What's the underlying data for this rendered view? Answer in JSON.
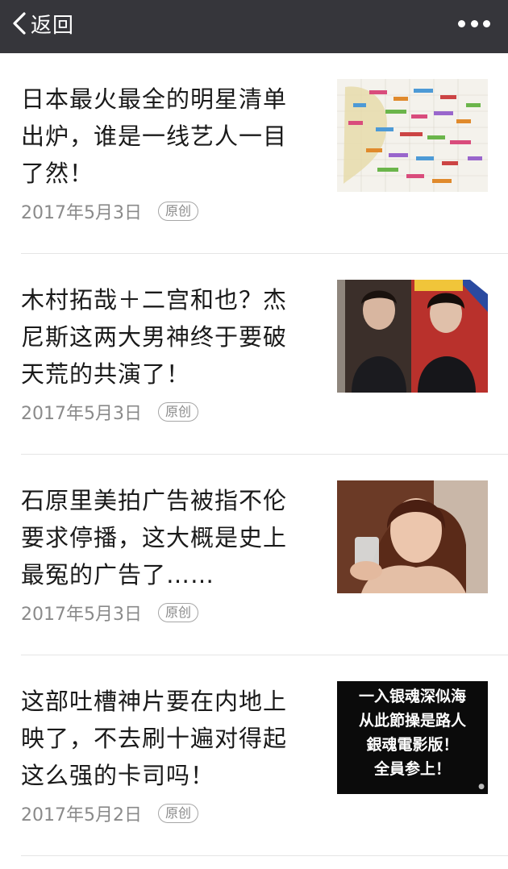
{
  "header": {
    "back_label": "返回",
    "more_icon": "more-horizontal-icon"
  },
  "articles": [
    {
      "title": "日本最火最全的明星清单出炉，谁是一线艺人一目了然！",
      "date": "2017年5月3日",
      "badge": "原创",
      "thumb": "celebrity-chart-thumbnail"
    },
    {
      "title": "木村拓哉＋二宫和也？杰尼斯这两大男神终于要破天荒的共演了！",
      "date": "2017年5月3日",
      "badge": "原创",
      "thumb": "two-actors-thumbnail"
    },
    {
      "title": "石原里美拍广告被指不伦要求停播，这大概是史上最冤的广告了……",
      "date": "2017年5月3日",
      "badge": "原创",
      "thumb": "actress-toast-thumbnail"
    },
    {
      "title": "这部吐槽神片要在内地上映了，不去刷十遍对得起这么强的卡司吗！",
      "date": "2017年5月2日",
      "badge": "原创",
      "thumb": "calligraphy-poster-thumbnail",
      "thumb_text": [
        "一入银魂深似海",
        "从此節操是路人",
        "銀魂電影版！",
        "全員参上！"
      ]
    }
  ],
  "colors": {
    "header_bg": "#36363b",
    "meta_text": "#8a8a8a",
    "divider": "#e5e5e5"
  }
}
